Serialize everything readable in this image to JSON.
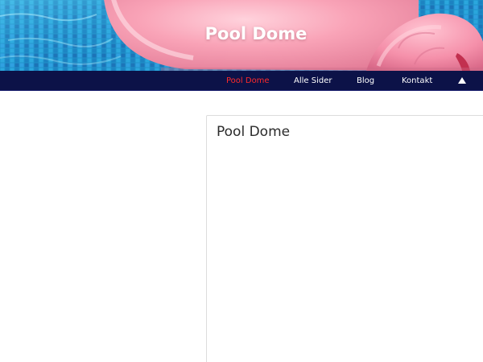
{
  "header": {
    "site_title": "Pool Dome"
  },
  "nav": {
    "items": [
      {
        "label": "Pool Dome",
        "active": true
      },
      {
        "label": "Alle Sider",
        "active": false
      },
      {
        "label": "Blog",
        "active": false
      },
      {
        "label": "Kontakt",
        "active": false
      }
    ],
    "scroll_top_icon": "caret-up-icon"
  },
  "content": {
    "title": "Pool Dome"
  },
  "colors": {
    "nav_background": "#0c1248",
    "nav_active": "#ff2a2a",
    "nav_text": "#ffffff",
    "header_pink": "#f7a9bb",
    "pool_blue": "#1ca3d6"
  }
}
